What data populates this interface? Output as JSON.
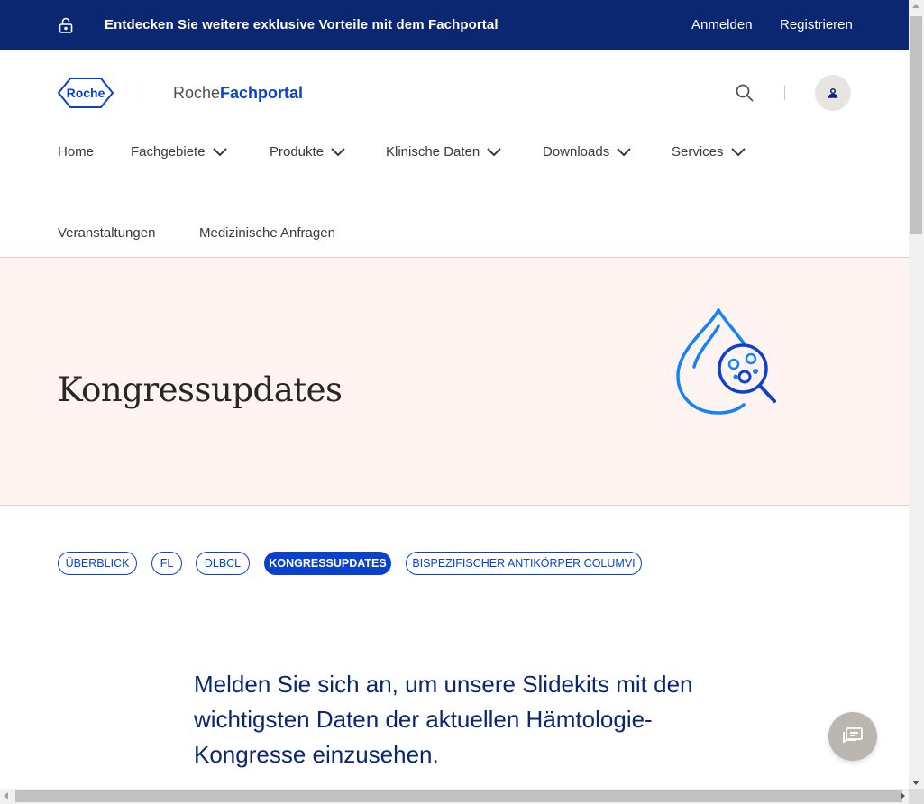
{
  "topbar": {
    "promo_text": "Entdecken Sie weitere exklusive Vorteile mit dem Fachportal",
    "login_label": "Anmelden",
    "register_label": "Registrieren",
    "background": "#0b2771"
  },
  "header": {
    "logo_text": "Roche",
    "brand_part1": "Roche",
    "brand_part2": "Fachportal"
  },
  "nav": {
    "items": [
      {
        "label": "Home",
        "dropdown": false
      },
      {
        "label": "Fachgebiete",
        "dropdown": true
      },
      {
        "label": "Produkte",
        "dropdown": true
      },
      {
        "label": "Klinische Daten",
        "dropdown": true
      },
      {
        "label": "Downloads",
        "dropdown": true
      },
      {
        "label": "Services",
        "dropdown": true
      },
      {
        "label": "Veranstaltungen",
        "dropdown": false
      },
      {
        "label": "Medizinische Anfragen",
        "dropdown": false
      }
    ]
  },
  "hero": {
    "title": "Kongressupdates",
    "icon": "blood-drop-magnifier-icon",
    "background": "#fff4f2"
  },
  "pills": [
    {
      "label": "ÜBERBLICK",
      "active": false
    },
    {
      "label": "FL",
      "active": false
    },
    {
      "label": "DLBCL",
      "active": false
    },
    {
      "label": "KONGRESSUPDATES",
      "active": true
    },
    {
      "label": "BISPEZIFISCHER ANTIKÖRPER COLUMVI",
      "active": false
    }
  ],
  "content": {
    "lead": "Melden Sie sich an, um unsere Slidekits mit den wichtigsten Daten der aktuellen Hämtologie-Kongresse einzusehen."
  },
  "colors": {
    "accent": "#0b41cd",
    "navy": "#0b2771"
  }
}
